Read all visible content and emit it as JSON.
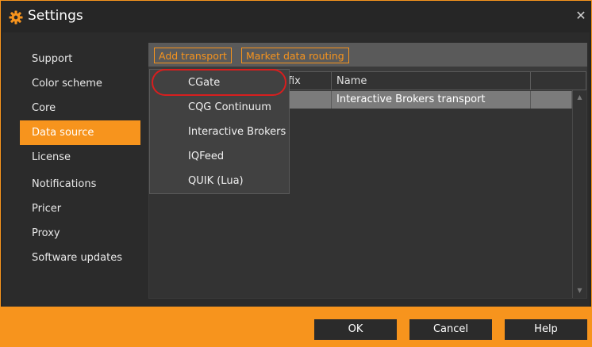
{
  "window": {
    "title": "Settings"
  },
  "sidebar": {
    "items": [
      {
        "label": "Support"
      },
      {
        "label": "Color scheme"
      },
      {
        "label": "Core"
      },
      {
        "label": "Data source",
        "active": true
      },
      {
        "label": "License"
      },
      {
        "label": "Notifications"
      },
      {
        "label": "Pricer"
      },
      {
        "label": "Proxy"
      },
      {
        "label": "Software updates"
      }
    ]
  },
  "toolbar": {
    "add_transport": "Add transport",
    "market_data_routing": "Market data routing"
  },
  "grid": {
    "columns": [
      "efix",
      "Name"
    ],
    "rows": [
      {
        "name": "Interactive Brokers transport"
      }
    ]
  },
  "add_transport_menu": {
    "items": [
      "CGate",
      "CQG Continuum",
      "Interactive Brokers",
      "IQFeed",
      "QUIK (Lua)"
    ],
    "highlighted": "CGate"
  },
  "footer": {
    "ok": "OK",
    "cancel": "Cancel",
    "help": "Help"
  },
  "colors": {
    "accent": "#f7941d",
    "background": "#2b2b2b",
    "highlight_outline": "#d81e1e"
  },
  "icons": {
    "title": "gear-icon",
    "close": "close-icon"
  }
}
